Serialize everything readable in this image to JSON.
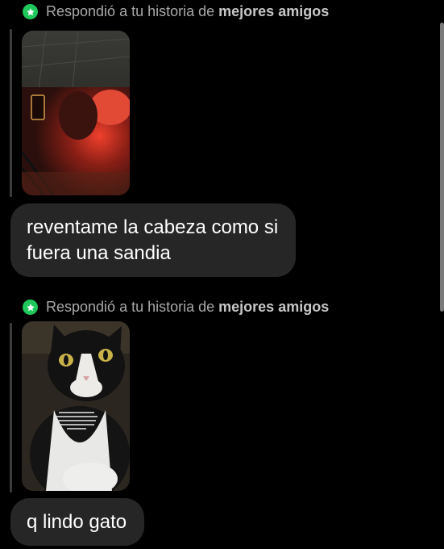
{
  "replies": [
    {
      "header": {
        "prefix": "Respondió a tu historia de ",
        "audience": "mejores amigos"
      },
      "message_lines": [
        "reventame la cabeza como si",
        "fuera una sandia"
      ]
    },
    {
      "header": {
        "prefix": "Respondió a tu historia de ",
        "audience": "mejores amigos"
      },
      "message_lines": [
        "q lindo gato"
      ]
    }
  ],
  "colors": {
    "background": "#000000",
    "bubble": "#262626",
    "close_friends_badge": "#1ec85a",
    "header_text": "#a8a8a8"
  },
  "icons": {
    "close_friends": "star-icon"
  }
}
